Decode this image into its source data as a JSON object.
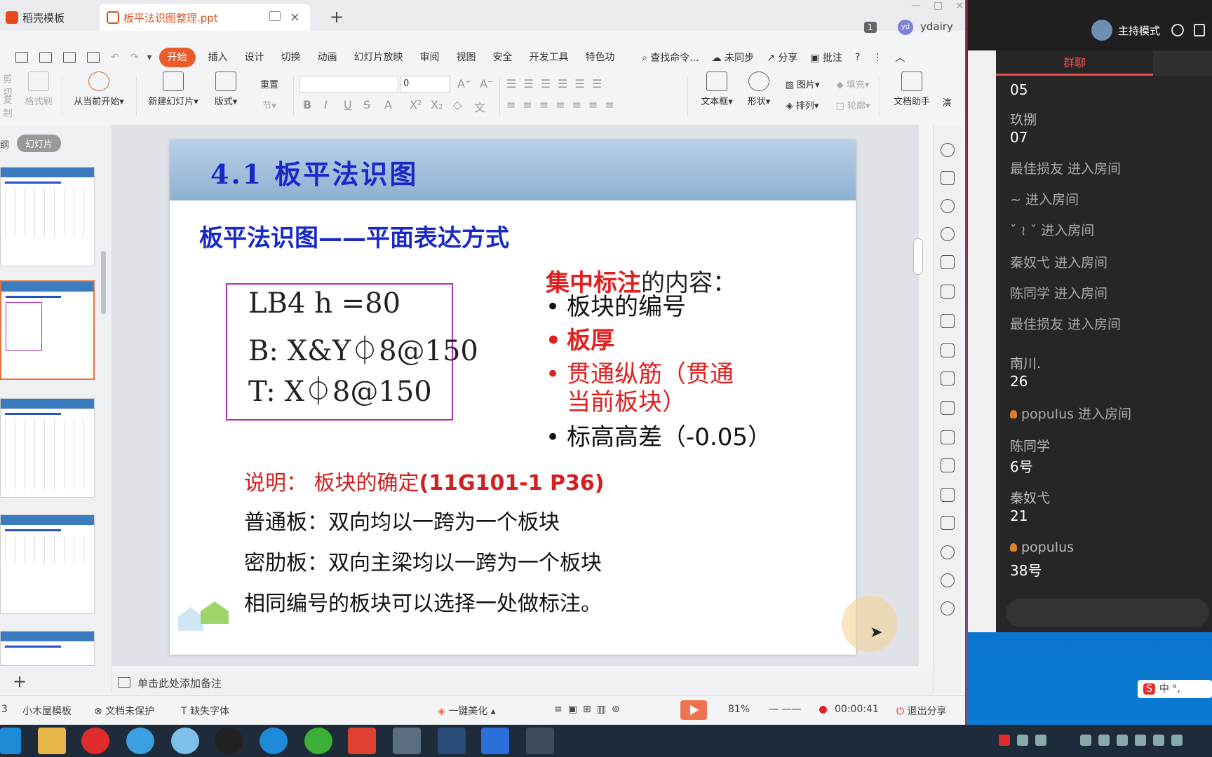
{
  "tabs": {
    "template_tab": "稻壳模板",
    "doc_tab": "板平法识图整理.ppt",
    "page_badge": "1",
    "user": "ydairy",
    "user_avatar": "yd"
  },
  "menu": {
    "items": [
      "开始",
      "插入",
      "设计",
      "切换",
      "动画",
      "幻灯片放映",
      "审阅",
      "视图",
      "安全",
      "开发工具",
      "特色功"
    ],
    "active": "开始",
    "search": "查找命令...",
    "sync": "未同步",
    "share": "分享",
    "comment": "批注"
  },
  "ribbon": {
    "cut": "剪切",
    "copy": "复制",
    "format_painter": "格式刷",
    "play_from_current": "从当前开始",
    "new_slide": "新建幻灯片",
    "layout": "版式",
    "reset": "重置",
    "section": "节",
    "font_size": "0",
    "textbox": "文本框",
    "shape": "形状",
    "picture": "图片",
    "arrange": "排列",
    "fill": "填充",
    "outline": "轮廓",
    "doc_assistant": "文档助手",
    "presenter": "演"
  },
  "left_panel": {
    "outline": "纲",
    "slides": "幻灯片"
  },
  "slide": {
    "title": "4.1 板平法识图",
    "subtitle": "板平法识图——平面表达方式",
    "code_lines": [
      "LB4  h =80",
      "B: X&Y⏀8@150",
      "T: X⏀8@150"
    ],
    "content_head_red": "集中标注",
    "content_head_rest": "的内容：",
    "bullets": [
      {
        "text": "板块的编号",
        "color": "#111111"
      },
      {
        "text": "板厚",
        "color": "#e02020"
      },
      {
        "text": "贯通纵筋（贯通",
        "color": "#e02020"
      },
      {
        "text": "当前板块）",
        "color": "#e02020"
      },
      {
        "text": "标高高差（-0.05）",
        "color": "#111111"
      }
    ],
    "note_label": "说明：  板块的确定",
    "note_ref": "(11G101-1 P36)",
    "notes": [
      "普通板：双向均以一跨为一个板块",
      "密肋板：双向主梁均以一跨为一个板块",
      "相同编号的板块可以选择一处做标注。"
    ]
  },
  "notes_bar": "单击此处添加备注",
  "status": {
    "slide_no": "3",
    "template": "小木屋模板",
    "protect": "文档未保护",
    "missing_font": "缺失字体",
    "beautify": "一键美化",
    "zoom": "81%",
    "timer": "00:00:41",
    "exit_share": "退出分享"
  },
  "chat": {
    "host_mode": "主持模式",
    "tab": "群聊",
    "messages": [
      {
        "text": "05",
        "kind": "val"
      },
      {
        "text": "玖捌",
        "kind": "name"
      },
      {
        "text": "07",
        "kind": "val"
      },
      {
        "text": "最佳损友 进入房间",
        "kind": "sys"
      },
      {
        "text": "~ 进入房间",
        "kind": "sys"
      },
      {
        "text": "ˇ  ≀   ˇ 进入房间",
        "kind": "sys"
      },
      {
        "text": "秦奴弋 进入房间",
        "kind": "sys"
      },
      {
        "text": "陈同学 进入房间",
        "kind": "sys"
      },
      {
        "text": "最佳损友 进入房间",
        "kind": "sys"
      },
      {
        "text": "南川.",
        "kind": "name"
      },
      {
        "text": "26",
        "kind": "val"
      },
      {
        "text": "populus 进入房间",
        "kind": "sys"
      },
      {
        "text": "陈同学",
        "kind": "name"
      },
      {
        "text": "6号",
        "kind": "val"
      },
      {
        "text": "秦奴弋",
        "kind": "name"
      },
      {
        "text": "21",
        "kind": "val"
      },
      {
        "text": "populus",
        "kind": "name"
      },
      {
        "text": "38号",
        "kind": "val"
      }
    ],
    "ime": "中 °, "
  },
  "taskbar": {
    "apps": [
      "edge",
      "explorer",
      "netease-music",
      "photos",
      "fan",
      "qq",
      "browser",
      "wechat",
      "jiang",
      "academy",
      "cad",
      "wps",
      "ke"
    ]
  },
  "colors": {
    "accent": "#e85d2b",
    "slide_blue": "#1a28c8",
    "slide_red": "#e02020"
  }
}
